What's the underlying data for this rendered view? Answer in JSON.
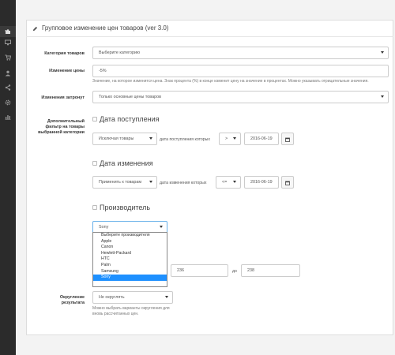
{
  "sidebar": {
    "icons": [
      "puzzle-icon",
      "monitor-icon",
      "cart-icon",
      "user-icon",
      "share-icon",
      "gear-icon",
      "bar-chart-icon"
    ]
  },
  "header": {
    "title": "Групповое изменение цен товаров (ver 3.0)",
    "icon": "pencil-icon"
  },
  "form": {
    "category": {
      "label": "Категория товаров",
      "value": "Выберите категорию"
    },
    "price_change": {
      "label": "Изменение цены",
      "value": "-5%",
      "help": "Значение, на которое изменится цена. Знак процента (%) в конце изменит цену на значение в процентах. Можно указывать отрицательные значения."
    },
    "affects": {
      "label": "Изменения затронут",
      "value": "Только основные цены товаров"
    },
    "filter_label": "Дополнительный фильтр на товары выбранной категории",
    "arrival": {
      "title": "Дата поступления",
      "mode": "Исключая товары",
      "text": "дата поступления которых",
      "op": ">",
      "date": "2016-06-19"
    },
    "modified": {
      "title": "Дата изменения",
      "mode": "Применить к товарам",
      "text": "дата изменения которых",
      "op": "<=",
      "date": "2016-06-19"
    },
    "manufacturer": {
      "title": "Производитель",
      "selected": "Sony",
      "options": [
        "Выберите производителя",
        "Apple",
        "Canon",
        "Hewlett-Packard",
        "HTC",
        "Palm",
        "Samsung",
        "Sony"
      ]
    },
    "range": {
      "from": "236",
      "to_label": "до",
      "to": "238"
    },
    "rounding": {
      "label": "Округление результата",
      "value": "Не округлять",
      "help": "Можно выбрать варианты округления для вновь рассчитанных цен."
    }
  }
}
